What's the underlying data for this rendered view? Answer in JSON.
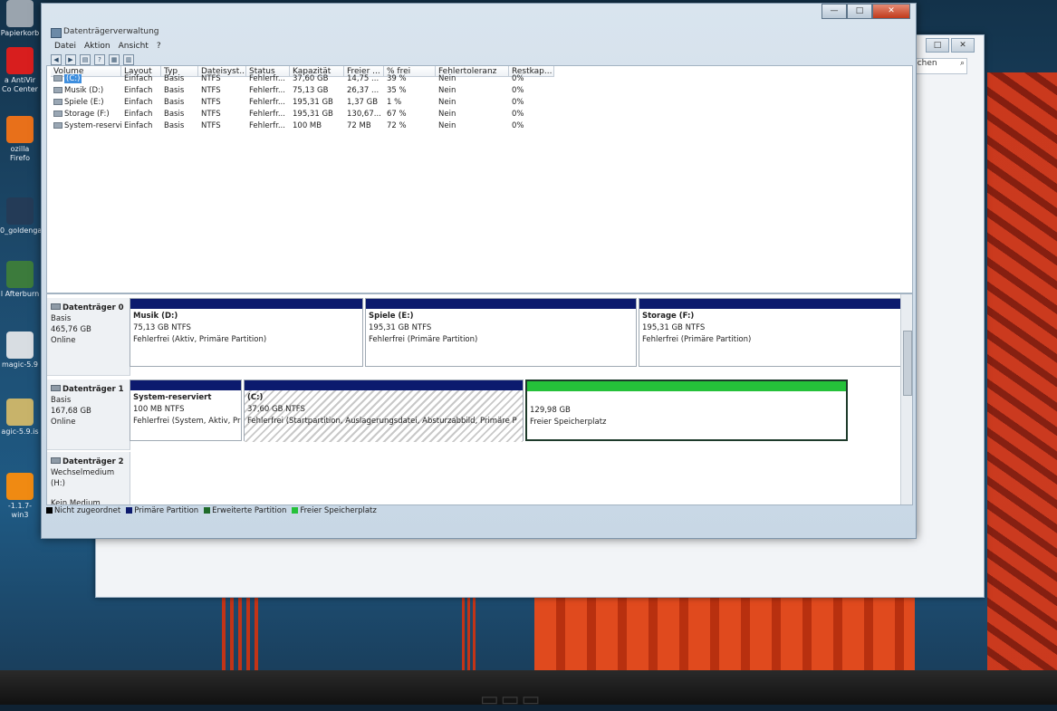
{
  "desktop": {
    "icons": [
      {
        "label": "Papierkorb",
        "color": "#9aa4ae"
      },
      {
        "label": "a AntiVir Co Center",
        "color": "#d81e1e"
      },
      {
        "label": "ozilla Firefo",
        "color": "#e8701a"
      },
      {
        "label": "0_goldenga",
        "color": "#243b57"
      },
      {
        "label": "l Afterburn",
        "color": "#3c7b3c"
      },
      {
        "label": "magic-5.9",
        "color": "#d8dde2"
      },
      {
        "label": "agic-5.9.is",
        "color": "#c8b36a"
      },
      {
        "label": "-1.1.7-win3",
        "color": "#f08a12"
      }
    ]
  },
  "background_window": {
    "search_placeholder": "uchen",
    "buttons": [
      "□",
      "✕"
    ]
  },
  "window": {
    "title": "Datenträgerverwaltung",
    "caption_buttons": [
      "—",
      "□",
      "✕"
    ],
    "menu": [
      "Datei",
      "Aktion",
      "Ansicht",
      "?"
    ],
    "toolbar": [
      "◀",
      "▶",
      "▤",
      "?",
      "▦",
      "▥"
    ]
  },
  "volume_list": {
    "columns": [
      "Volume",
      "Layout",
      "Typ",
      "Dateisyst...",
      "Status",
      "Kapazität",
      "Freier ...",
      "% frei",
      "Fehlertoleranz",
      "Restkap..."
    ],
    "rows": [
      {
        "volume": "(C:)",
        "layout": "Einfach",
        "typ": "Basis",
        "fs": "NTFS",
        "status": "Fehlerfr...",
        "kap": "37,60 GB",
        "frei": "14,75 ...",
        "pct": "39 %",
        "ft": "Nein",
        "rest": "0%",
        "selected": true
      },
      {
        "volume": "Musik (D:)",
        "layout": "Einfach",
        "typ": "Basis",
        "fs": "NTFS",
        "status": "Fehlerfr...",
        "kap": "75,13 GB",
        "frei": "26,37 ...",
        "pct": "35 %",
        "ft": "Nein",
        "rest": "0%"
      },
      {
        "volume": "Spiele (E:)",
        "layout": "Einfach",
        "typ": "Basis",
        "fs": "NTFS",
        "status": "Fehlerfr...",
        "kap": "195,31 GB",
        "frei": "1,37 GB",
        "pct": "1 %",
        "ft": "Nein",
        "rest": "0%"
      },
      {
        "volume": "Storage (F:)",
        "layout": "Einfach",
        "typ": "Basis",
        "fs": "NTFS",
        "status": "Fehlerfr...",
        "kap": "195,31 GB",
        "frei": "130,67...",
        "pct": "67 %",
        "ft": "Nein",
        "rest": "0%"
      },
      {
        "volume": "System-reservi...",
        "layout": "Einfach",
        "typ": "Basis",
        "fs": "NTFS",
        "status": "Fehlerfr...",
        "kap": "100 MB",
        "frei": "72 MB",
        "pct": "72 %",
        "ft": "Nein",
        "rest": "0%"
      }
    ]
  },
  "disks": [
    {
      "name": "Datenträger 0",
      "kind": "Basis",
      "size": "465,76 GB",
      "state": "Online",
      "partitions": [
        {
          "title": "Musik  (D:)",
          "size": "75,13 GB NTFS",
          "status": "Fehlerfrei (Aktiv, Primäre Partition)"
        },
        {
          "title": "Spiele  (E:)",
          "size": "195,31 GB NTFS",
          "status": "Fehlerfrei (Primäre Partition)"
        },
        {
          "title": "Storage  (F:)",
          "size": "195,31 GB NTFS",
          "status": "Fehlerfrei (Primäre Partition)"
        }
      ]
    },
    {
      "name": "Datenträger 1",
      "kind": "Basis",
      "size": "167,68 GB",
      "state": "Online",
      "partitions": [
        {
          "title": "System-reserviert",
          "size": "100 MB NTFS",
          "status": "Fehlerfrei (System, Aktiv, Prim"
        },
        {
          "title": "(C:)",
          "size": "37,60 GB NTFS",
          "status": "Fehlerfrei (Startpartition, Auslagerungsdatei, Absturzabbild, Primäre P"
        },
        {
          "title": "",
          "size": "129,98 GB",
          "status": "Freier Speicherplatz"
        }
      ]
    },
    {
      "name": "Datenträger 2",
      "kind": "Wechselmedium (H:)",
      "size": "",
      "state": "Kein Medium"
    }
  ],
  "legend": [
    {
      "label": "Nicht zugeordnet",
      "color": "#000000"
    },
    {
      "label": "Primäre Partition",
      "color": "#0c1a6e"
    },
    {
      "label": "Erweiterte Partition",
      "color": "#1f6b2a"
    },
    {
      "label": "Freier Speicherplatz",
      "color": "#25c13a"
    }
  ]
}
